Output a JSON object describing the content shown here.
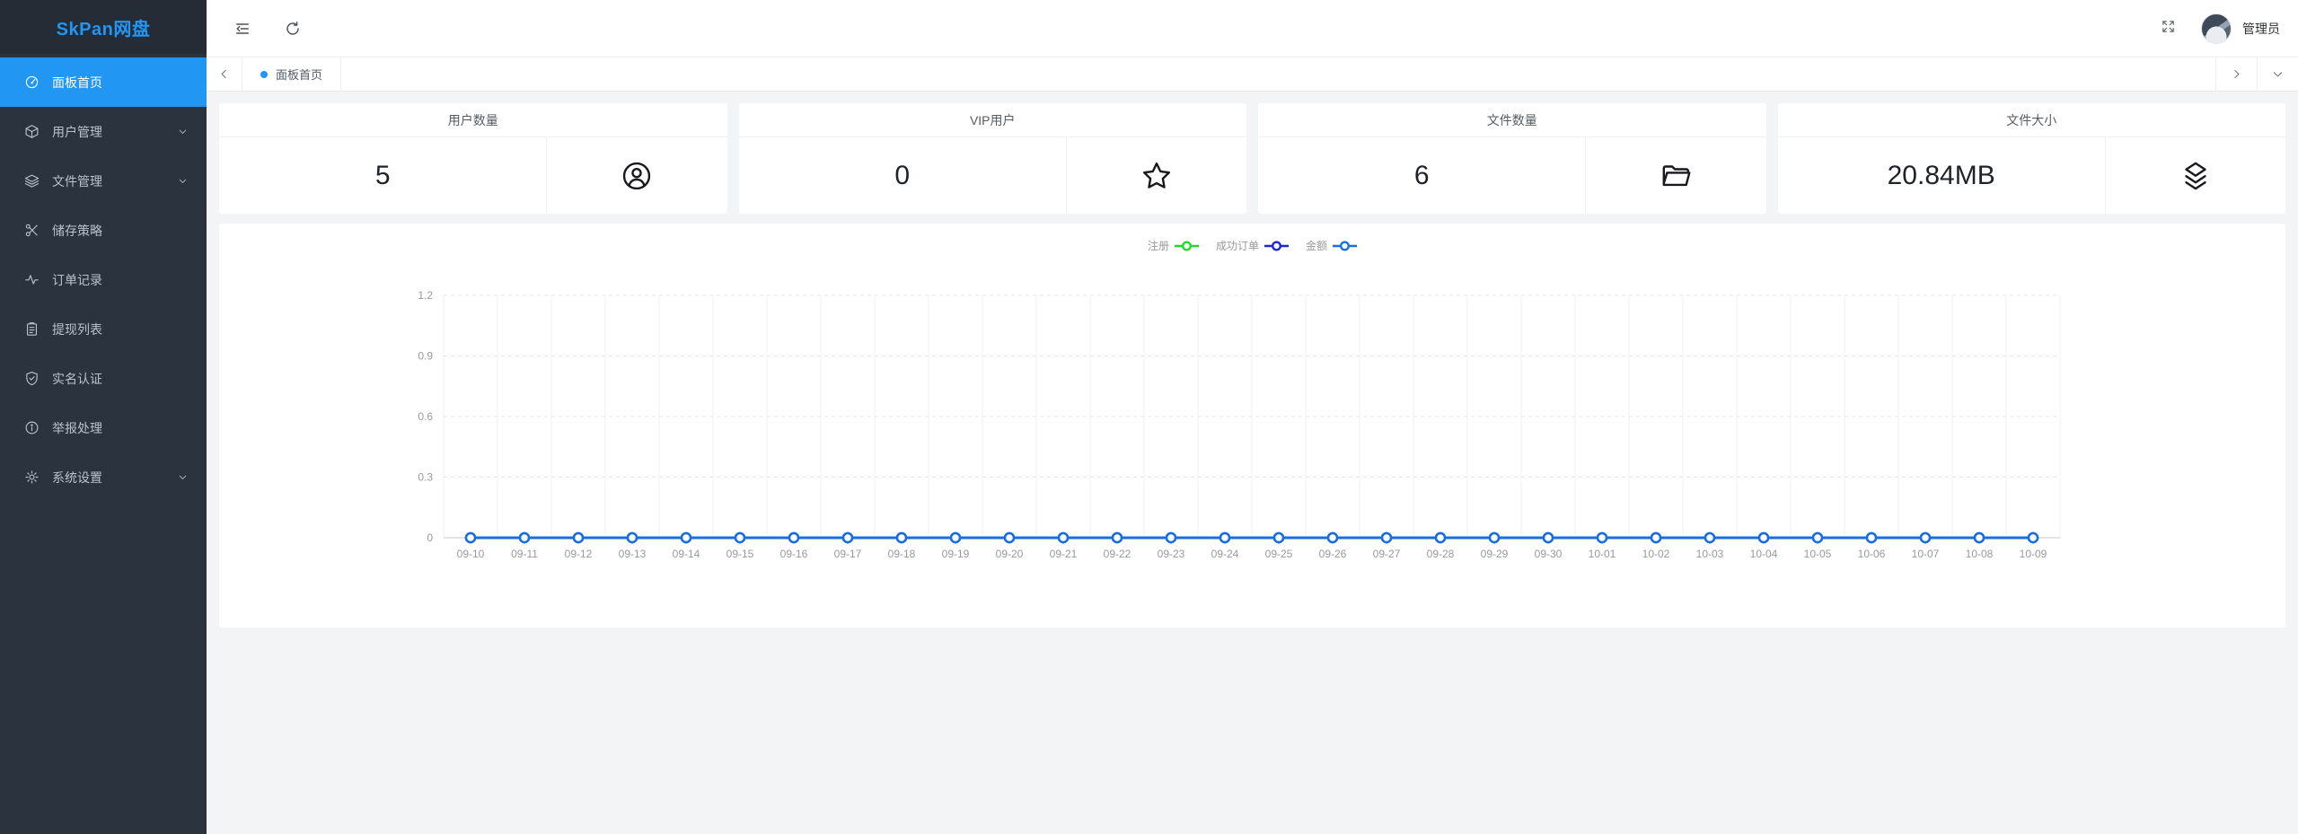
{
  "app": {
    "title": "SkPan网盘",
    "admin_name": "管理员"
  },
  "sidebar": {
    "items": [
      {
        "label": "面板首页",
        "icon": "dashboard-icon",
        "active": true,
        "expandable": false
      },
      {
        "label": "用户管理",
        "icon": "cube-icon",
        "active": false,
        "expandable": true
      },
      {
        "label": "文件管理",
        "icon": "layers-icon",
        "active": false,
        "expandable": true
      },
      {
        "label": "储存策略",
        "icon": "scissors-icon",
        "active": false,
        "expandable": false
      },
      {
        "label": "订单记录",
        "icon": "activity-icon",
        "active": false,
        "expandable": false
      },
      {
        "label": "提现列表",
        "icon": "clipboard-icon",
        "active": false,
        "expandable": false
      },
      {
        "label": "实名认证",
        "icon": "shield-check-icon",
        "active": false,
        "expandable": false
      },
      {
        "label": "举报处理",
        "icon": "info-circle-icon",
        "active": false,
        "expandable": false
      },
      {
        "label": "系统设置",
        "icon": "gear-icon",
        "active": false,
        "expandable": true
      }
    ]
  },
  "tabs": {
    "active_tab": "面板首页"
  },
  "stats": [
    {
      "title": "用户数量",
      "value": "5",
      "icon": "user-circle-icon"
    },
    {
      "title": "VIP用户",
      "value": "0",
      "icon": "star-icon"
    },
    {
      "title": "文件数量",
      "value": "6",
      "icon": "folder-open-icon"
    },
    {
      "title": "文件大小",
      "value": "20.84MB",
      "icon": "stack-icon"
    }
  ],
  "colors": {
    "accent_blue": "#2196f3",
    "page_bg": "#f3f4f5",
    "sidebar_bg": "#2a333e"
  },
  "chart_data": {
    "type": "line",
    "title": "",
    "xlabel": "",
    "ylabel": "",
    "ylim": [
      0,
      1.2
    ],
    "yticks": [
      0,
      0.3,
      0.6,
      0.9,
      1.2
    ],
    "grid": true,
    "legend_position": "top-center",
    "categories": [
      "09-10",
      "09-11",
      "09-12",
      "09-13",
      "09-14",
      "09-15",
      "09-16",
      "09-17",
      "09-18",
      "09-19",
      "09-20",
      "09-21",
      "09-22",
      "09-23",
      "09-24",
      "09-25",
      "09-26",
      "09-27",
      "09-28",
      "09-29",
      "09-30",
      "10-01",
      "10-02",
      "10-03",
      "10-04",
      "10-05",
      "10-06",
      "10-07",
      "10-08",
      "10-09"
    ],
    "series": [
      {
        "name": "注册",
        "color": "#1ddb2c",
        "values": [
          0,
          0,
          0,
          0,
          0,
          0,
          0,
          0,
          0,
          0,
          0,
          0,
          0,
          0,
          0,
          0,
          0,
          0,
          0,
          0,
          0,
          0,
          0,
          0,
          0,
          0,
          0,
          0,
          0,
          0
        ]
      },
      {
        "name": "成功订单",
        "color": "#1c25d8",
        "values": [
          0,
          0,
          0,
          0,
          0,
          0,
          0,
          0,
          0,
          0,
          0,
          0,
          0,
          0,
          0,
          0,
          0,
          0,
          0,
          0,
          0,
          0,
          0,
          0,
          0,
          0,
          0,
          0,
          0,
          0
        ]
      },
      {
        "name": "金额",
        "color": "#1a6edf",
        "values": [
          0,
          0,
          0,
          0,
          0,
          0,
          0,
          0,
          0,
          0,
          0,
          0,
          0,
          0,
          0,
          0,
          0,
          0,
          0,
          0,
          0,
          0,
          0,
          0,
          0,
          0,
          0,
          0,
          0,
          0
        ]
      }
    ]
  }
}
